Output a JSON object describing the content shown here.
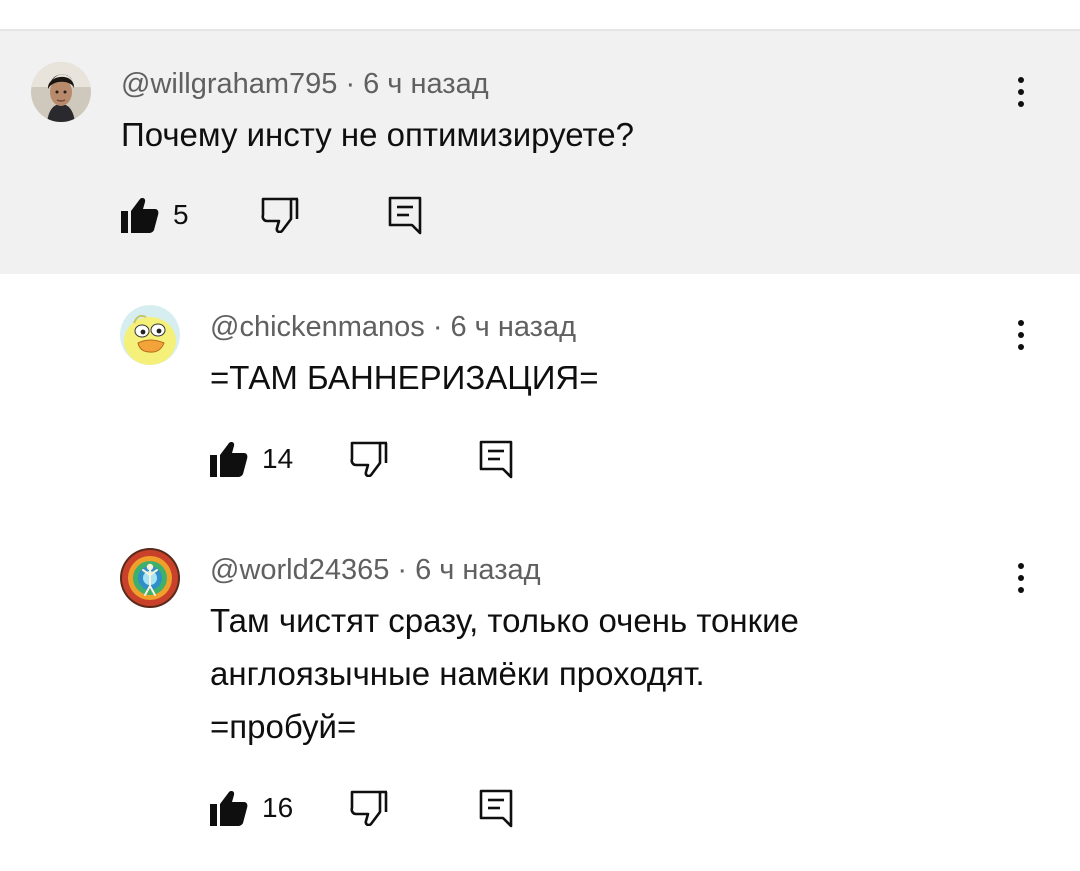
{
  "comments": [
    {
      "username": "@willgraham795",
      "separator": "·",
      "time": "6 ч назад",
      "text": "Почему инсту не оптимизируете?",
      "likes": "5",
      "avatar_icon": "portrait-avatar",
      "highlighted": true
    },
    {
      "username": "@chickenmanos",
      "separator": "·",
      "time": "6 ч назад",
      "text": "=ТАМ БАННЕРИЗАЦИЯ=",
      "likes": "14",
      "avatar_icon": "yellow-duck-avatar",
      "highlighted": false
    },
    {
      "username": "@world24365",
      "separator": "·",
      "time": "6 ч назад",
      "text": "Там чистят сразу, только очень тонкие\nанглоязычные намёки проходят.\n=пробуй=",
      "likes": "16",
      "avatar_icon": "psychedelic-figure-avatar",
      "highlighted": false
    }
  ],
  "icons": {
    "like": "thumbs-up-filled-icon",
    "dislike": "thumbs-down-outline-icon",
    "reply": "reply-comment-icon",
    "menu": "more-vertical-icon"
  },
  "colors": {
    "highlight_background": "#f1f1f1",
    "meta_text": "#606060",
    "body_text": "#0f0f0f"
  }
}
